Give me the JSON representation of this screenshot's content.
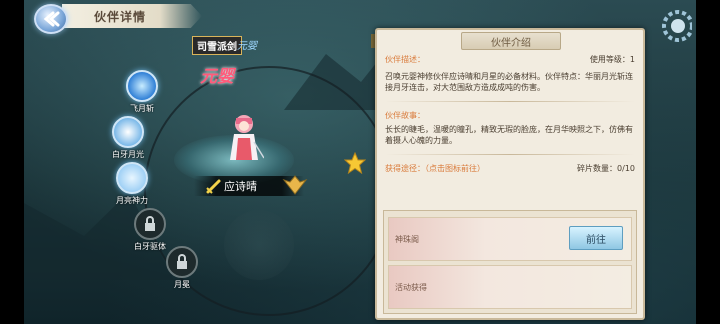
{
  "header": {
    "title": "伙伴详情"
  },
  "character": {
    "faction_tag": "司雪派剑",
    "faction_name": "元婴",
    "title": "元婴",
    "name": "应诗晴"
  },
  "skills": [
    {
      "label": "飞月斩",
      "locked": false,
      "color": "#2f7fd6"
    },
    {
      "label": "白牙月光",
      "locked": false,
      "color": "#7ab8e8"
    },
    {
      "label": "月亮神力",
      "locked": false,
      "color": "#9fd0f5"
    },
    {
      "label": "白牙驱体",
      "locked": true,
      "color": "#1e2a2c"
    },
    {
      "label": "月冕",
      "locked": true,
      "color": "#1e2a2c"
    }
  ],
  "panel": {
    "tab_label": "伙伴介绍",
    "desc_heading": "伙伴描述：",
    "level_req": "使用等级：1",
    "desc_text": "召唤元婴神修伙伴应诗晴和月星的必备材料。伙伴特点：华丽月光斩连接月牙连击，对大范围敌方造成成吨的伤害。",
    "story_heading": "伙伴故事：",
    "story_text": "长长的睫毛，温暖的瞳孔，精致无瑕的脸庞，在月华映照之下，仿佛有着摄人心魄的力量。",
    "acquire_heading": "获得途径：（点击图标前往）",
    "fragment_count": "碎片数量：0/10",
    "sources": [
      {
        "label": "神珠阁",
        "button": "前往"
      },
      {
        "label": "活动获得"
      }
    ]
  },
  "colors": {
    "accent_orange": "#d97a3a",
    "panel_bg": "#f2ece0",
    "title_pink": "#ff5a7a"
  }
}
